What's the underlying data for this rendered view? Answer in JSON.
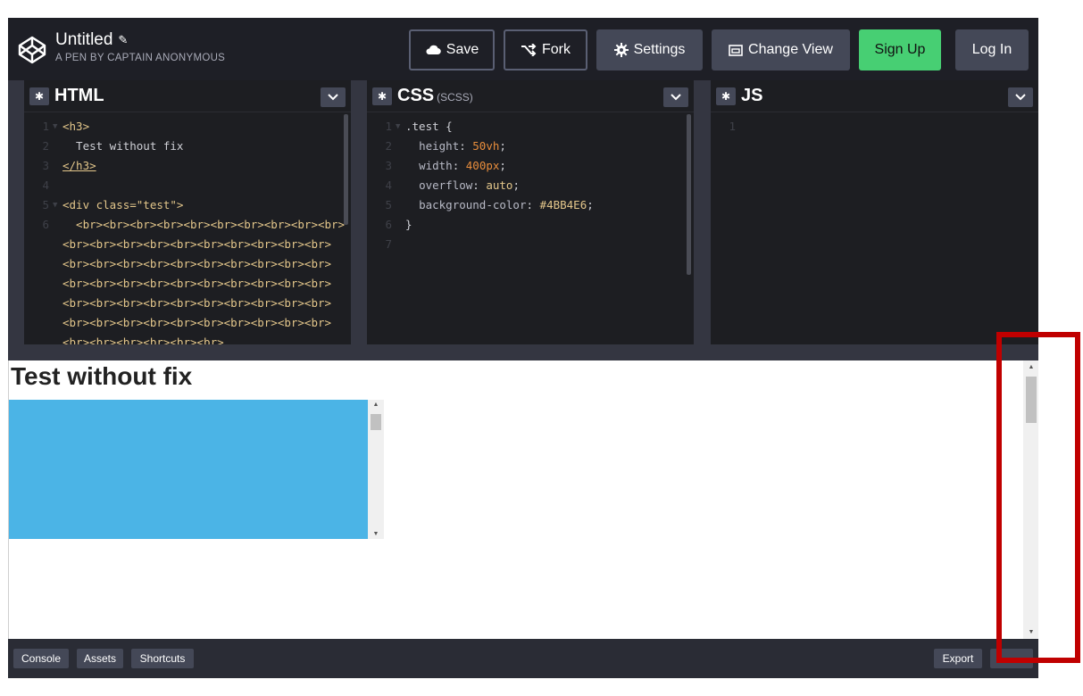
{
  "header": {
    "title": "Untitled",
    "subtitle": "A PEN BY CAPTAIN ANONYMOUS",
    "buttons": {
      "save": "Save",
      "fork": "Fork",
      "settings": "Settings",
      "change_view": "Change View",
      "sign_up": "Sign Up",
      "log_in": "Log In"
    }
  },
  "editors": {
    "html": {
      "name": "HTML",
      "lines": [
        "1",
        "2",
        "3",
        "4",
        "5",
        "6"
      ],
      "code": [
        "<h3>",
        "  Test without fix",
        "</h3>",
        "",
        "<div class=\"test\">",
        "  <br><br><br><br><br><br><br><br><br><br>",
        "<br><br><br><br><br><br><br><br><br><br>",
        "<br><br><br><br><br><br><br><br><br><br>",
        "<br><br><br><br><br><br><br><br><br><br>",
        "<br><br><br><br><br><br><br><br><br><br>",
        "<br><br><br><br><br><br><br><br><br><br>",
        "<br><br><br><br><br><br>"
      ]
    },
    "css": {
      "name": "CSS",
      "preprocessor": "(SCSS)",
      "lines": [
        "1",
        "2",
        "3",
        "4",
        "5",
        "6",
        "7"
      ],
      "code": {
        "selector": ".test {",
        "height_prop": "height",
        "height_val": "50vh",
        "width_prop": "width",
        "width_val": "400px",
        "overflow_prop": "overflow",
        "overflow_val": "auto",
        "bg_prop": "background-color",
        "bg_val": "#4BB4E6",
        "close": "}"
      }
    },
    "js": {
      "name": "JS",
      "lines": [
        "1"
      ]
    }
  },
  "preview": {
    "heading": "Test without fix",
    "test_box_color": "#4BB4E6"
  },
  "footer": {
    "console": "Console",
    "assets": "Assets",
    "shortcuts": "Shortcuts",
    "export": "Export"
  },
  "colors": {
    "accent_green": "#47CF73",
    "highlight_red": "#C00000",
    "editor_bg": "#1D1E22"
  }
}
